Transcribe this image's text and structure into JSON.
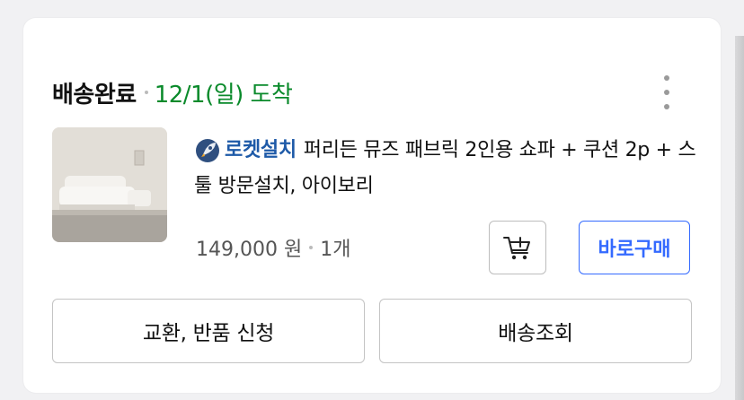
{
  "order": {
    "status_label": "배송완료",
    "arrival_text": "12/1(일) 도착"
  },
  "product": {
    "badge_label": "로켓설치",
    "badge_icon": "rocket-icon",
    "name": "퍼리든 뮤즈 패브릭 2인용 쇼파 + 쿠션 2p + 스툴 방문설치, 아이보리",
    "price": "149,000 원",
    "quantity": "1개",
    "image_alt": "sofa-product-image"
  },
  "actions": {
    "cart_icon": "add-to-cart-icon",
    "buy_now_label": "바로구매",
    "exchange_return_label": "교환, 반품 신청",
    "track_delivery_label": "배송조회"
  },
  "colors": {
    "arrival_green": "#0a8a2b",
    "rocket_blue": "#1e5aa8",
    "buy_blue": "#346aff"
  }
}
